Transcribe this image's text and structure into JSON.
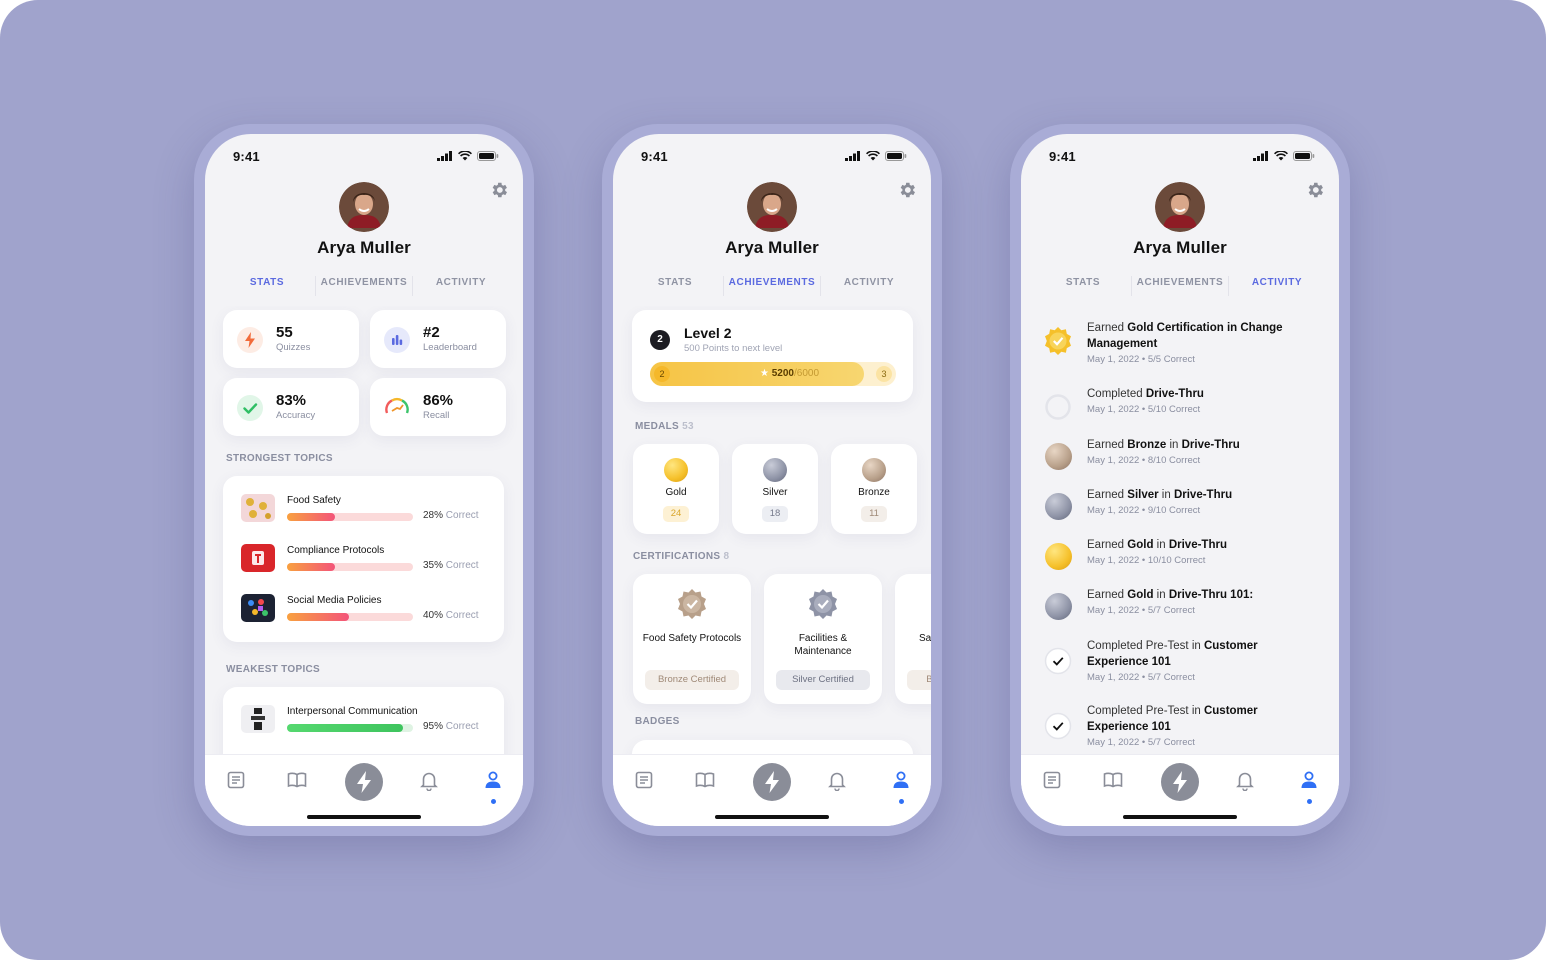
{
  "status": {
    "time": "9:41"
  },
  "profile": {
    "name": "Arya Muller"
  },
  "tabs": [
    "STATS",
    "ACHIEVEMENTS",
    "ACTIVITY"
  ],
  "colors": {
    "accent": "#5b6ae0",
    "background": "#a0a3cc",
    "gold": "#f5c02a",
    "silver": "#8e93a6",
    "bronze": "#b8a08a",
    "nav_active": "#2f6ff5"
  },
  "stats": {
    "cards": [
      {
        "value": "55",
        "label": "Quizzes",
        "icon": "bolt-icon"
      },
      {
        "value": "#2",
        "label": "Leaderboard",
        "icon": "leaderboard-icon"
      },
      {
        "value": "83%",
        "label": "Accuracy",
        "icon": "check-icon"
      },
      {
        "value": "86%",
        "label": "Recall",
        "icon": "gauge-icon"
      }
    ],
    "strongest_label": "STRONGEST TOPICS",
    "strongest": [
      {
        "name": "Food Safety",
        "pct": "28%",
        "progress": 0.38
      },
      {
        "name": "Compliance Protocols",
        "pct": "35%",
        "progress": 0.38
      },
      {
        "name": "Social Media Policies",
        "pct": "40%",
        "progress": 0.49
      }
    ],
    "weakest_label": "WEAKEST TOPICS",
    "weakest": [
      {
        "name": "Interpersonal Communication",
        "pct": "95%",
        "progress": 0.92
      }
    ],
    "correct_word": "Correct"
  },
  "achievements": {
    "level_badge": "2",
    "level_title": "Level 2",
    "level_sub": "500 Points to next level",
    "bar_start": "2",
    "bar_end": "3",
    "bar_value": "5200",
    "bar_total": "/6000",
    "bar_progress": 0.87,
    "medals_label": "MEDALS",
    "medals_count": "53",
    "medals": [
      {
        "name": "Gold",
        "count": "24"
      },
      {
        "name": "Silver",
        "count": "18"
      },
      {
        "name": "Bronze",
        "count": "11"
      }
    ],
    "cert_label": "CERTIFICATIONS",
    "cert_count": "8",
    "certs": [
      {
        "name": "Food Safety Protocols",
        "badge": "Bronze Certified"
      },
      {
        "name": "Facilities & Maintenance",
        "badge": "Silver Certified"
      },
      {
        "name": "Sa",
        "badge": "Bro"
      }
    ],
    "badges_label": "BADGES"
  },
  "activity": [
    {
      "pre": "Earned ",
      "bold": "Gold Certification in Change Management",
      "mid": "",
      "bold2": "",
      "meta": "May 1, 2022 • 5/5 Correct",
      "icon": "gold-cert-icon"
    },
    {
      "pre": "Completed ",
      "bold": "Drive-Thru",
      "mid": "",
      "bold2": "",
      "meta": "May 1, 2022 • 5/10 Correct",
      "icon": "progress-ring-icon"
    },
    {
      "pre": "Earned ",
      "bold": "Bronze",
      "mid": " in ",
      "bold2": "Drive-Thru",
      "meta": "May 1, 2022 • 8/10 Correct",
      "icon": "bronze-medal-icon"
    },
    {
      "pre": "Earned ",
      "bold": "Silver",
      "mid": " in ",
      "bold2": "Drive-Thru",
      "meta": "May 1, 2022 • 9/10 Correct",
      "icon": "silver-medal-icon"
    },
    {
      "pre": "Earned ",
      "bold": "Gold",
      "mid": " in ",
      "bold2": "Drive-Thru",
      "meta": "May 1, 2022 • 10/10 Correct",
      "icon": "gold-medal-icon"
    },
    {
      "pre": "Earned ",
      "bold": "Gold",
      "mid": " in ",
      "bold2": "Drive-Thru 101:",
      "meta": "May 1, 2022 • 5/7 Correct",
      "icon": "silver-medal-icon"
    },
    {
      "pre": "Completed Pre-Test in ",
      "bold": "Customer Experience 101",
      "mid": "",
      "bold2": "",
      "meta": "May 1, 2022 • 5/7 Correct",
      "icon": "check-circle-icon"
    },
    {
      "pre": "Completed Pre-Test in ",
      "bold": "Customer Experience 101",
      "mid": "",
      "bold2": "",
      "meta": "May 1, 2022 • 5/7 Correct",
      "icon": "check-circle-icon"
    }
  ],
  "nav": [
    {
      "icon": "feed-icon"
    },
    {
      "icon": "book-icon"
    },
    {
      "icon": "bolt-icon"
    },
    {
      "icon": "bell-icon"
    },
    {
      "icon": "profile-icon"
    }
  ]
}
